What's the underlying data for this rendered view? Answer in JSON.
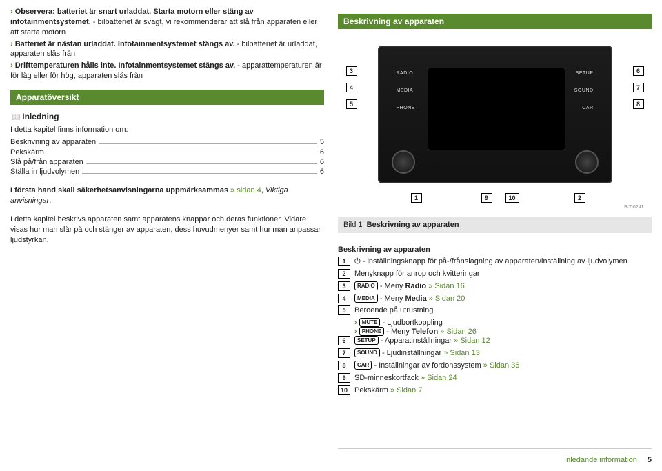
{
  "intro": {
    "line1_pre": "Observera: batteriet är snart urladdat. Starta motorn eller stäng av infotainmentsystemet.",
    "line1_post": " - bilbatteriet är svagt, vi rekommenderar att slå från apparaten eller att starta motorn",
    "line2_pre": "Batteriet är nästan urladdat. Infotainmentsystemet stängs av.",
    "line2_post": " - bilbatteriet är urladdat, apparaten slås från",
    "line3_pre": "Drifttemperaturen hålls inte. Infotainmentsystemet stängs av.",
    "line3_post": " - apparattemperaturen är för låg eller för hög, apparaten slås från"
  },
  "left": {
    "header": "Apparatöversikt",
    "inledning": "Inledning",
    "toc_title": "I detta kapitel finns information om:",
    "toc": [
      {
        "label": "Beskrivning av apparaten",
        "page": "5"
      },
      {
        "label": "Pekskärm",
        "page": "6"
      },
      {
        "label": "Slå på/från apparaten",
        "page": "6"
      },
      {
        "label": "Ställa in ljudvolymen",
        "page": "6"
      }
    ],
    "para1_pre": "I första hand skall säkerhetsanvisningarna uppmärksammas ",
    "para1_link": "» sidan 4",
    "para1_post": ", ",
    "para1_italic": "Viktiga anvisningar",
    "para1_end": ".",
    "para2": "I detta kapitel beskrivs apparaten samt apparatens knappar och deras funktioner. Vidare visas hur man slår på och stänger av apparaten, dess huvudmenyer samt hur man anpassar ljudstyrkan."
  },
  "right": {
    "header": "Beskrivning av apparaten",
    "device_buttons": {
      "radio": "RADIO",
      "media": "MEDIA",
      "phone": "PHONE",
      "setup": "SETUP",
      "sound": "SOUND",
      "car": "CAR"
    },
    "nums": {
      "1": "1",
      "2": "2",
      "3": "3",
      "4": "4",
      "5": "5",
      "6": "6",
      "7": "7",
      "8": "8",
      "9": "9",
      "10": "10"
    },
    "bit": "BIT-0241",
    "caption_bild": "Bild 1",
    "caption_text": "Beskrivning av apparaten",
    "desc_title": "Beskrivning av apparaten",
    "items": [
      {
        "n": "1",
        "icon": "⏻",
        "text": " - inställningsknapp för på-/frånslagning av apparaten/inställning av ljudvolymen"
      },
      {
        "n": "2",
        "text": "Menyknapp för anrop och kvitteringar"
      },
      {
        "n": "3",
        "pill": "RADIO",
        "text": " - Meny ",
        "bold": "Radio ",
        "link": "» Sidan 16"
      },
      {
        "n": "4",
        "pill": "MEDIA",
        "text": " - Meny ",
        "bold": "Media ",
        "link": "» Sidan 20"
      },
      {
        "n": "5",
        "text": "Beroende på utrustning"
      },
      {
        "n": "6",
        "pill": "SETUP",
        "text": " - Apparatinställningar ",
        "link": "» Sidan 12"
      },
      {
        "n": "7",
        "pill": "SOUND",
        "text": " - Ljudinställningar ",
        "link": "» Sidan 13"
      },
      {
        "n": "8",
        "pill": "CAR",
        "text": " - Inställningar av fordonssystem ",
        "link": "» Sidan 36"
      },
      {
        "n": "9",
        "text": "SD-minneskortfack ",
        "link": "» Sidan 24"
      },
      {
        "n": "10",
        "text": "Pekskärm ",
        "link": "» Sidan 7"
      }
    ],
    "sub5": [
      {
        "pill": "MUTE",
        "text": " - Ljudbortkoppling"
      },
      {
        "pill": "PHONE",
        "text": " - Meny ",
        "bold": "Telefon ",
        "link": "» Sidan 26"
      }
    ]
  },
  "footer": {
    "section": "Inledande information",
    "page": "5"
  }
}
